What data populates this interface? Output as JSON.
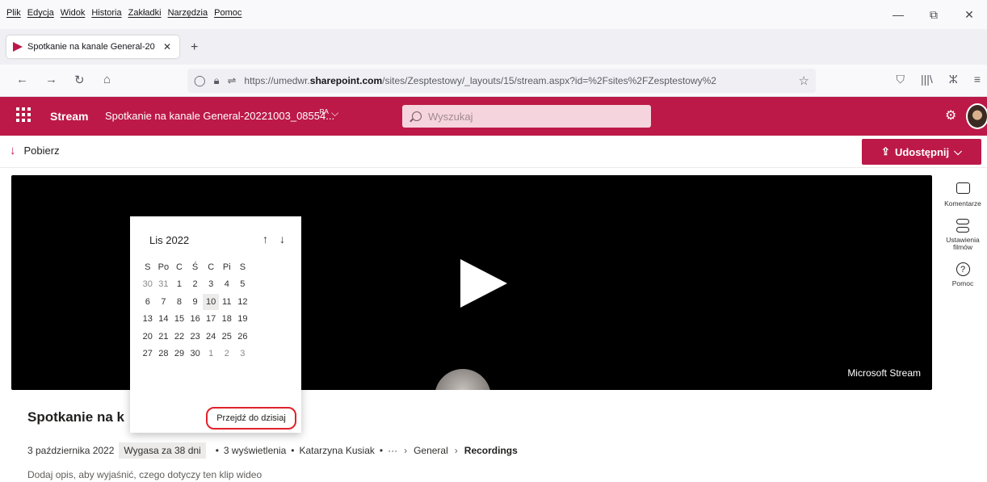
{
  "menu": {
    "items": [
      "Plik",
      "Edycja",
      "Widok",
      "Historia",
      "Zakładki",
      "Narzędzia",
      "Pomoc"
    ]
  },
  "window": {
    "minimize": "—",
    "restore": "⧉",
    "close": "✕"
  },
  "tab": {
    "title": "Spotkanie na kanale General-20",
    "close": "✕",
    "new_tab": "+"
  },
  "nav": {
    "back": "←",
    "forward": "→",
    "reload": "↻",
    "home": "⌂",
    "url_prefix": "https://umedwr.",
    "url_domain": "sharepoint.com",
    "url_rest": "/sites/Zesptestowy/_layouts/15/stream.aspx?id=%2Fsites%2FZesptestowy%2",
    "bookmark": "☆",
    "right_icons": [
      "⛉",
      "|||\\",
      "ⵣ",
      "≡"
    ]
  },
  "stream": {
    "brand": "Stream",
    "video_title": "Spotkanie na kanale General-20221003_08554...",
    "title_icon": "ᴿᴬ ⌵",
    "search_placeholder": "Wyszukaj",
    "gear": "⚙"
  },
  "commands": {
    "download_icon": "↓",
    "download_label": "Pobierz",
    "share_icon": "⇪",
    "share_label": "Udostępnij",
    "share_chevron": "⌵"
  },
  "video": {
    "watermark": "Microsoft Stream"
  },
  "rail": {
    "comments_label": "Komentarze",
    "settings_label": "Ustawienia filmów",
    "help_label": "Pomoc",
    "help_glyph": "?"
  },
  "calendar": {
    "month_label": "Lis 2022",
    "prev_arrow": "↑",
    "next_arrow": "↓",
    "weekdays": [
      "S",
      "Po",
      "C",
      "Ś",
      "C",
      "Pi",
      "S"
    ],
    "weeks": [
      [
        "30",
        "31",
        "1",
        "2",
        "3",
        "4",
        "5"
      ],
      [
        "6",
        "7",
        "8",
        "9",
        "10",
        "11",
        "12"
      ],
      [
        "13",
        "14",
        "15",
        "16",
        "17",
        "18",
        "19"
      ],
      [
        "20",
        "21",
        "22",
        "23",
        "24",
        "25",
        "26"
      ],
      [
        "27",
        "28",
        "29",
        "30",
        "1",
        "2",
        "3"
      ]
    ],
    "today": "10",
    "go_to_today": "Przejdź do dzisiaj"
  },
  "details": {
    "title": "Spotkanie na k",
    "date": "3 października 2022",
    "expiry": "Wygasa za 38 dni",
    "views": "3 wyświetlenia",
    "author": "Katarzyna Kusiak",
    "more": "···",
    "crumb_1": "General",
    "crumb_2": "Recordings",
    "description": "Dodaj opis, aby wyjaśnić, czego dotyczy ten klip wideo"
  }
}
